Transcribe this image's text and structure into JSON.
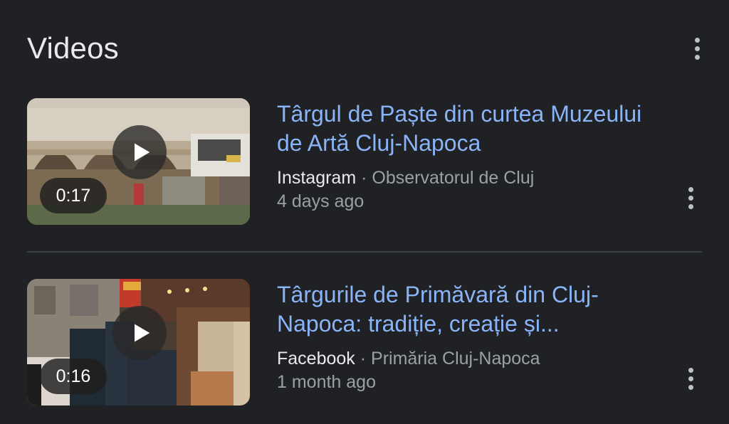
{
  "section": {
    "title": "Videos",
    "menu_icon": "more-vert-icon"
  },
  "videos": [
    {
      "title": "Târgul de Paște din curtea Muzeului de Artă Cluj-Napoca",
      "source": "Instagram",
      "separator": " · ",
      "channel": "Observatorul de Cluj",
      "age": "4 days ago",
      "duration": "0:17",
      "play_icon": "play-icon",
      "menu_icon": "more-vert-icon"
    },
    {
      "title": "Târgurile de Primăvară din Cluj-Napoca: tradiție, creație și...",
      "source": "Facebook",
      "separator": " · ",
      "channel": "Primăria Cluj-Napoca",
      "age": "1 month ago",
      "duration": "0:16",
      "play_icon": "play-icon",
      "menu_icon": "more-vert-icon"
    }
  ],
  "colors": {
    "background": "#202124",
    "link": "#8ab4f8",
    "primary_text": "#e8eaed",
    "secondary_text": "#9aa0a6",
    "divider": "#3c4043"
  }
}
